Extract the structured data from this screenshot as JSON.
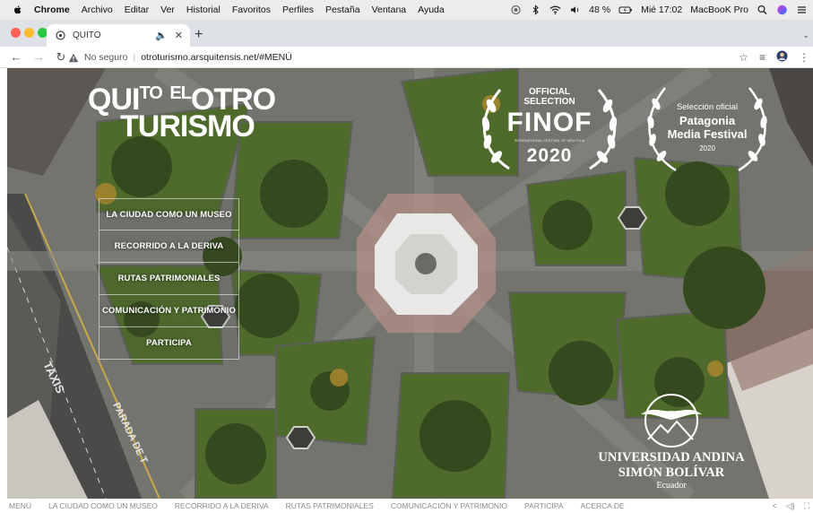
{
  "menubar": {
    "app": "Chrome",
    "items": [
      "Archivo",
      "Editar",
      "Ver",
      "Historial",
      "Favoritos",
      "Perfiles",
      "Pestaña",
      "Ventana",
      "Ayuda"
    ],
    "battery": "48 %",
    "clock": "Mié 17:02",
    "device": "MacBooK Pro"
  },
  "browser": {
    "tab_title": "QUITO",
    "new_tab": "+",
    "not_secure": "No seguro",
    "url": "otroturismo.arsquitensis.net/#MENÚ"
  },
  "hero": {
    "logo": {
      "q1": "QUI",
      "q2": "TO",
      "q3": "EL",
      "q4": "OTRO",
      "q5": "TURISMO"
    },
    "menu": [
      "LA CIUDAD COMO UN MUSEO",
      "RECORRIDO A LA DERIVA",
      "RUTAS PATRIMONIALES",
      "COMUNICACIÓN Y PATRIMONIO",
      "PARTICIPA"
    ],
    "finof": {
      "line1": "OFFICIAL",
      "line2": "SELECTION",
      "name": "FINOF",
      "small": "INTERNATIONAL FESTIVAL OF NEW FILM",
      "year": "2020"
    },
    "patagonia": {
      "line1": "Selección oficial",
      "name1": "Patagonia",
      "name2": "Media Festival",
      "year": "2020"
    },
    "university": {
      "line1": "UNIVERSIDAD ANDINA",
      "line2": "SIMÓN BOLÍVAR",
      "line3": "Ecuador"
    }
  },
  "bottom_nav": [
    "MENÚ",
    "LA CIUDAD COMO UN MUSEO",
    "RECORRIDO A LA DERIVA",
    "RUTAS PATRIMONIALES",
    "COMUNICACIÓN Y PATRIMONIO",
    "PARTICIPA",
    "ACERCA DE"
  ],
  "colors": {
    "menubar": "#ececec",
    "tabstrip": "#dee1e6",
    "pavement": "#6f6f6c",
    "garden": "#4f6b2c"
  }
}
